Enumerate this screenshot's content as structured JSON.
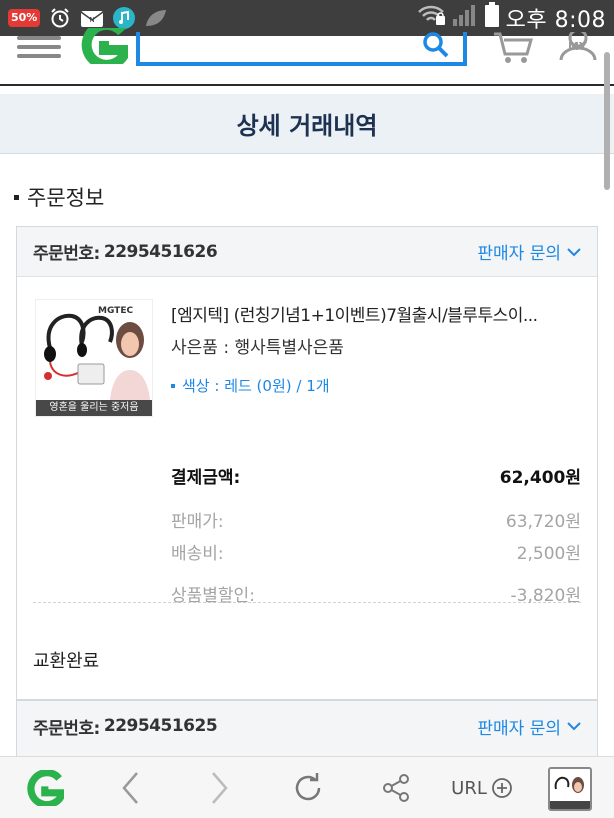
{
  "status_bar": {
    "battery_badge": "50%",
    "time": "오후 8:08"
  },
  "app_header": {
    "menu_icon": "hamburger-icon",
    "logo_icon": "g-logo-icon",
    "search_icon": "search-icon",
    "cart_icon": "cart-icon",
    "my_label": "MY"
  },
  "page": {
    "title": "상세 거래내역",
    "section_heading": "주문정보"
  },
  "orders": [
    {
      "order_no_label": "주문번호:",
      "order_no": "2295451626",
      "seller_inquiry": "판매자 문의",
      "product_name": "[엠지텍] (런칭기념1+1이벤트)7월출시/블루투스이...",
      "gift": "사은품 : 행사특별사은품",
      "option": "색상 : 레드 (0원) / 1개",
      "thumb_brand": "MGTEC",
      "thumb_caption": "영혼을 울리는 중저음",
      "prices": {
        "total_label": "결제금액:",
        "total_value": "62,400원",
        "sale_label": "판매가:",
        "sale_value": "63,720원",
        "ship_label": "배송비:",
        "ship_value": "2,500원",
        "discount_label": "상품별할인:",
        "discount_value": "-3,820원"
      },
      "status": "교환완료"
    },
    {
      "order_no_label": "주문번호:",
      "order_no": "2295451625",
      "seller_inquiry": "판매자 문의"
    }
  ],
  "bottom_bar": {
    "home_icon": "g-logo-icon",
    "back_icon": "chevron-left-icon",
    "forward_icon": "chevron-right-icon",
    "refresh_icon": "refresh-icon",
    "share_icon": "share-icon",
    "url_label": "URL",
    "tabs_icon": "tab-thumbnail"
  },
  "colors": {
    "accent": "#1e88e5",
    "title": "#1c3250",
    "brand_green": "#2bb24c"
  }
}
